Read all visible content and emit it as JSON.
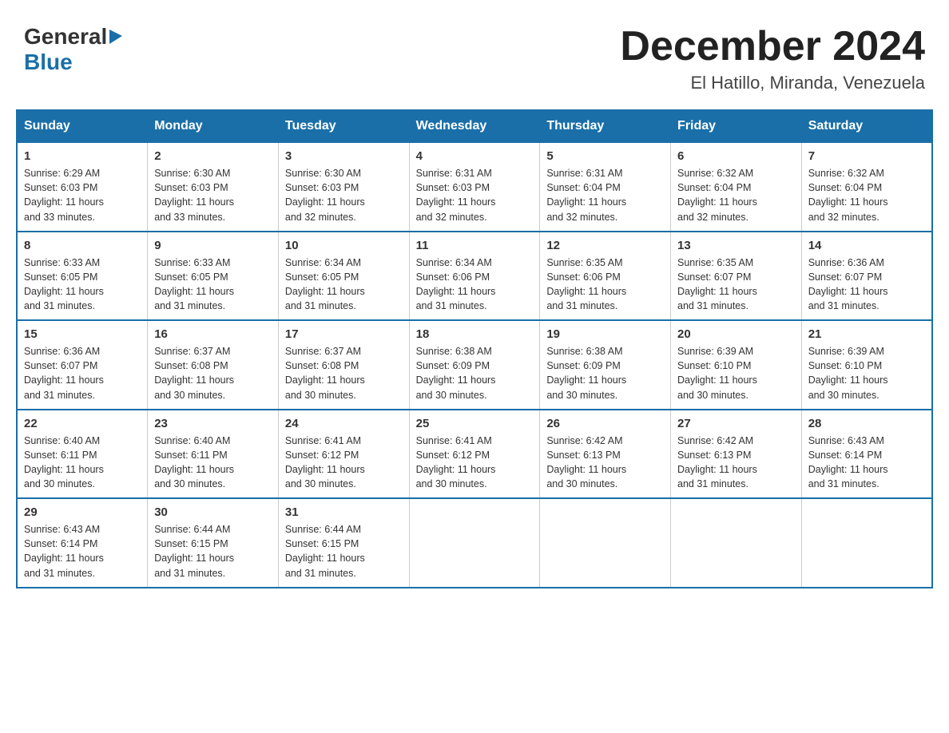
{
  "header": {
    "logo": {
      "general": "General",
      "blue": "Blue"
    },
    "title": "December 2024",
    "location": "El Hatillo, Miranda, Venezuela"
  },
  "calendar": {
    "days_of_week": [
      "Sunday",
      "Monday",
      "Tuesday",
      "Wednesday",
      "Thursday",
      "Friday",
      "Saturday"
    ],
    "weeks": [
      [
        {
          "day": "1",
          "info": "Sunrise: 6:29 AM\nSunset: 6:03 PM\nDaylight: 11 hours\nand 33 minutes."
        },
        {
          "day": "2",
          "info": "Sunrise: 6:30 AM\nSunset: 6:03 PM\nDaylight: 11 hours\nand 33 minutes."
        },
        {
          "day": "3",
          "info": "Sunrise: 6:30 AM\nSunset: 6:03 PM\nDaylight: 11 hours\nand 32 minutes."
        },
        {
          "day": "4",
          "info": "Sunrise: 6:31 AM\nSunset: 6:03 PM\nDaylight: 11 hours\nand 32 minutes."
        },
        {
          "day": "5",
          "info": "Sunrise: 6:31 AM\nSunset: 6:04 PM\nDaylight: 11 hours\nand 32 minutes."
        },
        {
          "day": "6",
          "info": "Sunrise: 6:32 AM\nSunset: 6:04 PM\nDaylight: 11 hours\nand 32 minutes."
        },
        {
          "day": "7",
          "info": "Sunrise: 6:32 AM\nSunset: 6:04 PM\nDaylight: 11 hours\nand 32 minutes."
        }
      ],
      [
        {
          "day": "8",
          "info": "Sunrise: 6:33 AM\nSunset: 6:05 PM\nDaylight: 11 hours\nand 31 minutes."
        },
        {
          "day": "9",
          "info": "Sunrise: 6:33 AM\nSunset: 6:05 PM\nDaylight: 11 hours\nand 31 minutes."
        },
        {
          "day": "10",
          "info": "Sunrise: 6:34 AM\nSunset: 6:05 PM\nDaylight: 11 hours\nand 31 minutes."
        },
        {
          "day": "11",
          "info": "Sunrise: 6:34 AM\nSunset: 6:06 PM\nDaylight: 11 hours\nand 31 minutes."
        },
        {
          "day": "12",
          "info": "Sunrise: 6:35 AM\nSunset: 6:06 PM\nDaylight: 11 hours\nand 31 minutes."
        },
        {
          "day": "13",
          "info": "Sunrise: 6:35 AM\nSunset: 6:07 PM\nDaylight: 11 hours\nand 31 minutes."
        },
        {
          "day": "14",
          "info": "Sunrise: 6:36 AM\nSunset: 6:07 PM\nDaylight: 11 hours\nand 31 minutes."
        }
      ],
      [
        {
          "day": "15",
          "info": "Sunrise: 6:36 AM\nSunset: 6:07 PM\nDaylight: 11 hours\nand 31 minutes."
        },
        {
          "day": "16",
          "info": "Sunrise: 6:37 AM\nSunset: 6:08 PM\nDaylight: 11 hours\nand 30 minutes."
        },
        {
          "day": "17",
          "info": "Sunrise: 6:37 AM\nSunset: 6:08 PM\nDaylight: 11 hours\nand 30 minutes."
        },
        {
          "day": "18",
          "info": "Sunrise: 6:38 AM\nSunset: 6:09 PM\nDaylight: 11 hours\nand 30 minutes."
        },
        {
          "day": "19",
          "info": "Sunrise: 6:38 AM\nSunset: 6:09 PM\nDaylight: 11 hours\nand 30 minutes."
        },
        {
          "day": "20",
          "info": "Sunrise: 6:39 AM\nSunset: 6:10 PM\nDaylight: 11 hours\nand 30 minutes."
        },
        {
          "day": "21",
          "info": "Sunrise: 6:39 AM\nSunset: 6:10 PM\nDaylight: 11 hours\nand 30 minutes."
        }
      ],
      [
        {
          "day": "22",
          "info": "Sunrise: 6:40 AM\nSunset: 6:11 PM\nDaylight: 11 hours\nand 30 minutes."
        },
        {
          "day": "23",
          "info": "Sunrise: 6:40 AM\nSunset: 6:11 PM\nDaylight: 11 hours\nand 30 minutes."
        },
        {
          "day": "24",
          "info": "Sunrise: 6:41 AM\nSunset: 6:12 PM\nDaylight: 11 hours\nand 30 minutes."
        },
        {
          "day": "25",
          "info": "Sunrise: 6:41 AM\nSunset: 6:12 PM\nDaylight: 11 hours\nand 30 minutes."
        },
        {
          "day": "26",
          "info": "Sunrise: 6:42 AM\nSunset: 6:13 PM\nDaylight: 11 hours\nand 30 minutes."
        },
        {
          "day": "27",
          "info": "Sunrise: 6:42 AM\nSunset: 6:13 PM\nDaylight: 11 hours\nand 31 minutes."
        },
        {
          "day": "28",
          "info": "Sunrise: 6:43 AM\nSunset: 6:14 PM\nDaylight: 11 hours\nand 31 minutes."
        }
      ],
      [
        {
          "day": "29",
          "info": "Sunrise: 6:43 AM\nSunset: 6:14 PM\nDaylight: 11 hours\nand 31 minutes."
        },
        {
          "day": "30",
          "info": "Sunrise: 6:44 AM\nSunset: 6:15 PM\nDaylight: 11 hours\nand 31 minutes."
        },
        {
          "day": "31",
          "info": "Sunrise: 6:44 AM\nSunset: 6:15 PM\nDaylight: 11 hours\nand 31 minutes."
        },
        {
          "day": "",
          "info": ""
        },
        {
          "day": "",
          "info": ""
        },
        {
          "day": "",
          "info": ""
        },
        {
          "day": "",
          "info": ""
        }
      ]
    ]
  }
}
